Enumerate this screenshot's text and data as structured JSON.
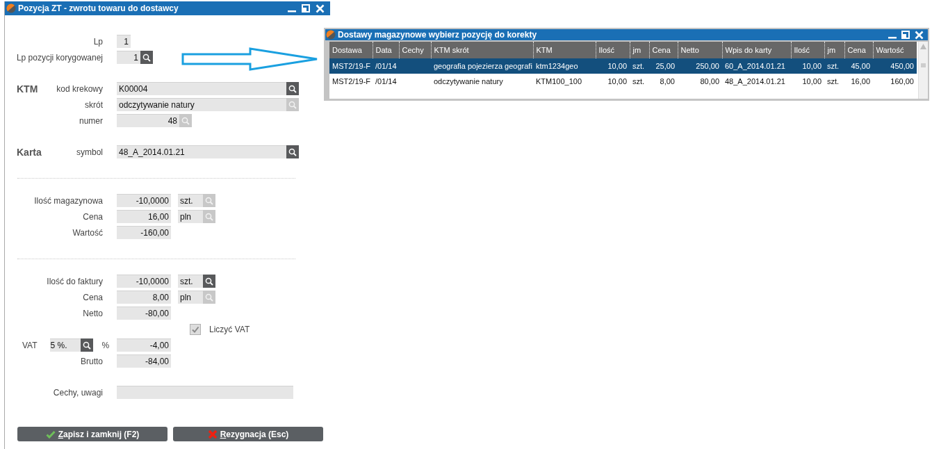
{
  "dialog": {
    "title": "Pozycja ZT - zwrotu towaru do dostawcy",
    "sections": [
      {
        "kind": "fields",
        "rows": [
          {
            "kind": "counter",
            "label": "Lp",
            "value": "1"
          },
          {
            "kind": "counter",
            "label": "Lp pozycji korygowanej",
            "value": "1",
            "lookup": {
              "disabled": false
            }
          }
        ]
      },
      {
        "kind": "fields",
        "heading": "KTM",
        "rows": [
          {
            "kind": "text",
            "label": "kod krekowy",
            "value": "K00004",
            "lookup": {
              "disabled": false
            }
          },
          {
            "kind": "text",
            "label": "skrót",
            "value": "odczytywanie natury",
            "lookup": {
              "disabled": true
            }
          },
          {
            "kind": "code",
            "label": "numer",
            "value": "48",
            "lookup": {
              "disabled": true
            }
          }
        ]
      },
      {
        "kind": "fields",
        "heading": "Karta",
        "rows": [
          {
            "kind": "text",
            "label": "symbol",
            "value": "48_A_2014.01.21",
            "lookup": {
              "disabled": false
            }
          }
        ]
      },
      {
        "kind": "divider"
      },
      {
        "kind": "fields",
        "rows": [
          {
            "kind": "amount",
            "label": "Ilość magazynowa",
            "value": "-10,0000",
            "unit": {
              "value": "szt.",
              "disabled": true
            }
          },
          {
            "kind": "amount",
            "label": "Cena",
            "value": "16,00",
            "unit": {
              "value": "pln",
              "disabled": true
            }
          },
          {
            "kind": "amount",
            "label": "Wartość",
            "value": "-160,00"
          }
        ]
      },
      {
        "kind": "divider"
      },
      {
        "kind": "fields",
        "rows": [
          {
            "kind": "amount",
            "label": "Ilość do faktury",
            "value": "-10,0000",
            "unit": {
              "value": "szt.",
              "disabled": false
            }
          },
          {
            "kind": "amount",
            "label": "Cena",
            "value": "8,00",
            "unit": {
              "value": "pln",
              "disabled": true
            }
          },
          {
            "kind": "amount",
            "label": "Netto",
            "value": "-80,00"
          },
          {
            "kind": "checkbox",
            "label": "Liczyć VAT",
            "checked": true,
            "disabled": true
          },
          {
            "kind": "vat",
            "label": "VAT",
            "rate": "5 %.",
            "lookup": {
              "disabled": false
            },
            "symbol": "%",
            "value": "-4,00"
          },
          {
            "kind": "amount",
            "label": "Brutto",
            "value": "-84,00"
          }
        ]
      },
      {
        "kind": "fields",
        "rows": [
          {
            "kind": "wide",
            "label": "Cechy, uwagi"
          }
        ]
      }
    ],
    "buttons": [
      {
        "kind": "save",
        "label": "Zapisz i zamknij (F2)"
      },
      {
        "kind": "cancel",
        "label": "Rezygnacja (Esc)"
      }
    ]
  },
  "picker": {
    "title": "Dostawy magazynowe wybierz pozycję do korekty",
    "columns": [
      {
        "label": "Dostawa",
        "kind": "text"
      },
      {
        "label": "Data",
        "kind": "text"
      },
      {
        "label": "Cechy",
        "kind": "text"
      },
      {
        "label": "KTM skrót",
        "kind": "text"
      },
      {
        "label": "KTM",
        "kind": "text"
      },
      {
        "label": "Ilość",
        "kind": "numeric"
      },
      {
        "label": "jm",
        "kind": "text"
      },
      {
        "label": "Cena",
        "kind": "numeric"
      },
      {
        "label": "Netto",
        "kind": "numeric"
      },
      {
        "label": "Wpis do karty",
        "kind": "text"
      },
      {
        "label": "Ilość",
        "kind": "numeric"
      },
      {
        "label": "jm",
        "kind": "text"
      },
      {
        "label": "Cena",
        "kind": "numeric"
      },
      {
        "label": "Wartość",
        "kind": "numeric"
      }
    ],
    "rows": [
      {
        "selected": true,
        "cells": [
          "MST2/19-F",
          "/01/14",
          "",
          "geografia pojezierza geografi",
          "ktm1234geo",
          "10,00",
          "szt.",
          "25,00",
          "250,00",
          "60_A_2014.01.21",
          "10,00",
          "szt.",
          "45,00",
          "450,00"
        ]
      },
      {
        "selected": false,
        "cells": [
          "MST2/19-F",
          "/01/14",
          "",
          "odczytywanie natury",
          "KTM100_100",
          "10,00",
          "szt.",
          "8,00",
          "80,00",
          "48_A_2014.01.21",
          "10,00",
          "szt.",
          "16,00",
          "160,00"
        ]
      }
    ]
  }
}
